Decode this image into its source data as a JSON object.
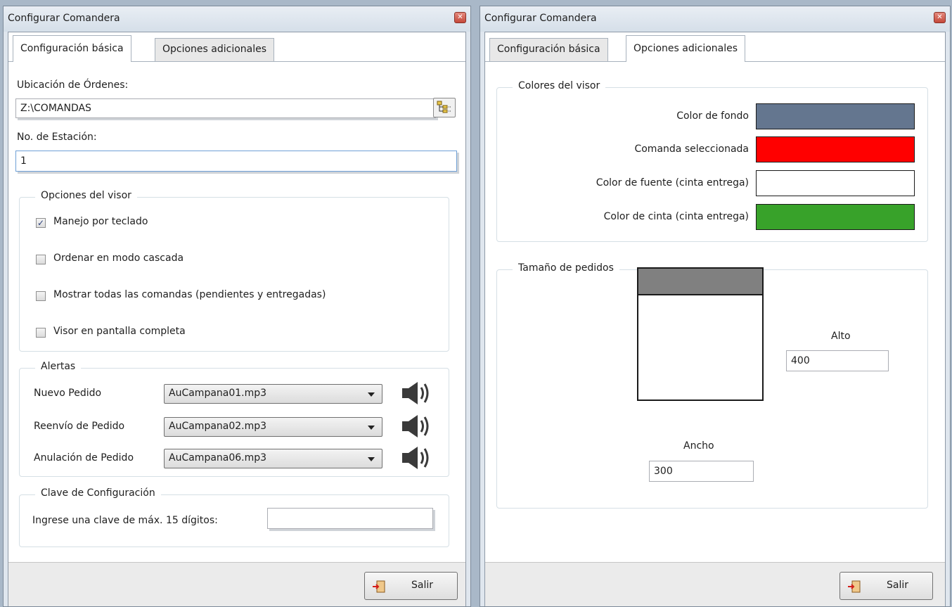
{
  "left_window": {
    "title": "Configurar Comandera",
    "tabs": [
      {
        "label": "Configuración básica",
        "active": true
      },
      {
        "label": "Opciones adicionales",
        "active": false
      }
    ],
    "orders_location": {
      "label": "Ubicación de Órdenes:",
      "value": "Z:\\COMANDAS"
    },
    "station": {
      "label": "No. de Estación:",
      "value": "1"
    },
    "viewer_options": {
      "legend": "Opciones del visor",
      "items": [
        {
          "label": "Manejo por teclado",
          "checked": true
        },
        {
          "label": "Ordenar en modo cascada",
          "checked": false
        },
        {
          "label": "Mostrar todas las comandas (pendientes y entregadas)",
          "checked": false
        },
        {
          "label": "Visor en pantalla completa",
          "checked": false
        }
      ]
    },
    "alerts": {
      "legend": "Alertas",
      "rows": [
        {
          "label": "Nuevo Pedido",
          "value": "AuCampana01.mp3"
        },
        {
          "label": "Reenvío de Pedido",
          "value": "AuCampana02.mp3"
        },
        {
          "label": "Anulación de Pedido",
          "value": "AuCampana06.mp3"
        }
      ]
    },
    "config_key": {
      "legend": "Clave de Configuración",
      "label": "Ingrese una clave de máx. 15 dígitos:",
      "value": ""
    },
    "exit_label": "Salir"
  },
  "right_window": {
    "title": "Configurar Comandera",
    "tabs": [
      {
        "label": "Configuración básica",
        "active": false
      },
      {
        "label": "Opciones adicionales",
        "active": true
      }
    ],
    "viewer_colors": {
      "legend": "Colores del visor",
      "rows": [
        {
          "label": "Color de fondo",
          "color": "#64768f"
        },
        {
          "label": "Comanda seleccionada",
          "color": "#ff0000"
        },
        {
          "label": "Color de fuente (cinta entrega)",
          "color": "#ffffff"
        },
        {
          "label": "Color de cinta (cinta entrega)",
          "color": "#38a22a"
        }
      ]
    },
    "order_size": {
      "legend": "Tamaño de pedidos",
      "height_label": "Alto",
      "height_value": "400",
      "width_label": "Ancho",
      "width_value": "300"
    },
    "exit_label": "Salir"
  },
  "icons": {
    "close": "close-icon",
    "browse": "folder-tree-icon",
    "speaker": "speaker-icon",
    "dropdown": "chevron-down-icon",
    "exit": "exit-door-icon"
  }
}
